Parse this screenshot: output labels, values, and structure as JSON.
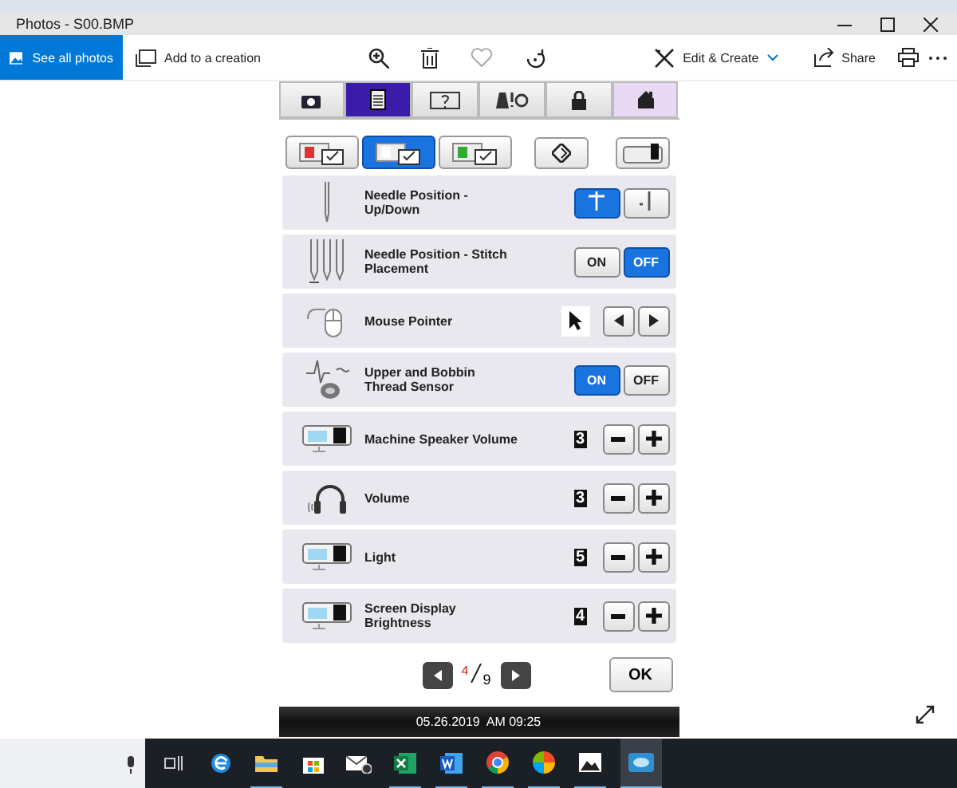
{
  "window": {
    "title": "Photos - S00.BMP"
  },
  "toolbar": {
    "see_all": "See all photos",
    "add": "Add to a creation",
    "edit": "Edit & Create",
    "share": "Share"
  },
  "screen": {
    "tabs": [
      {
        "selected": false
      },
      {
        "selected": true
      },
      {
        "selected": false
      },
      {
        "selected": false
      },
      {
        "selected": false
      },
      {
        "selected": false
      }
    ],
    "subtabs": [
      {
        "selected": false
      },
      {
        "selected": true
      },
      {
        "selected": false
      }
    ],
    "rows": [
      {
        "kind": "needle",
        "label": "Needle Position - Up/Down",
        "options": [
          {
            "selected": true
          },
          {
            "selected": false
          }
        ]
      },
      {
        "kind": "toggle",
        "label": "Needle Position - Stitch Placement",
        "on_label": "ON",
        "off_label": "OFF",
        "on": false
      },
      {
        "kind": "pointer",
        "label": "Mouse Pointer"
      },
      {
        "kind": "toggle",
        "label": "Upper and Bobbin Thread Sensor",
        "on_label": "ON",
        "off_label": "OFF",
        "on": true
      },
      {
        "kind": "number",
        "label": "Machine Speaker Volume",
        "value": "3"
      },
      {
        "kind": "number",
        "label": "Volume",
        "value": "3"
      },
      {
        "kind": "number",
        "label": "Light",
        "value": "5"
      },
      {
        "kind": "number",
        "label": "Screen Display Brightness",
        "value": "4"
      }
    ],
    "page": "4",
    "pages": "9",
    "ok": "OK",
    "datetime": "05.26.2019  AM 09:25"
  }
}
